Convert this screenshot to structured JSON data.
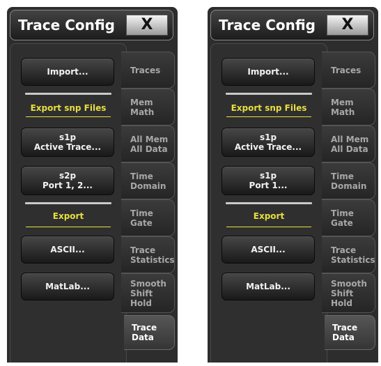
{
  "panels": [
    {
      "title": "Trace Config",
      "close_label": "X",
      "buttons": {
        "import": [
          "Import..."
        ],
        "s1p": [
          "s1p",
          "Active Trace..."
        ],
        "second": [
          "s2p",
          "Port 1, 2..."
        ],
        "ascii": [
          "ASCII..."
        ],
        "matlab": [
          "MatLab..."
        ]
      },
      "sections": {
        "export_snp": "Export snp Files",
        "export": "Export"
      },
      "tabs": [
        [
          "Traces"
        ],
        [
          "Mem",
          "Math"
        ],
        [
          "All Mem",
          "All Data"
        ],
        [
          "Time",
          "Domain"
        ],
        [
          "Time",
          "Gate"
        ],
        [
          "Trace",
          "Statistics"
        ],
        [
          "Smooth",
          "Shift",
          "Hold"
        ],
        [
          "Trace",
          "Data"
        ]
      ],
      "active_tab": 7
    },
    {
      "title": "Trace Config",
      "close_label": "X",
      "buttons": {
        "import": [
          "Import..."
        ],
        "s1p": [
          "s1p",
          "Active Trace..."
        ],
        "second": [
          "s1p",
          "Port 1..."
        ],
        "ascii": [
          "ASCII..."
        ],
        "matlab": [
          "MatLab..."
        ]
      },
      "sections": {
        "export_snp": "Export snp Files",
        "export": "Export"
      },
      "tabs": [
        [
          "Traces"
        ],
        [
          "Mem",
          "Math"
        ],
        [
          "All Mem",
          "All Data"
        ],
        [
          "Time",
          "Domain"
        ],
        [
          "Time",
          "Gate"
        ],
        [
          "Trace",
          "Statistics"
        ],
        [
          "Smooth",
          "Shift",
          "Hold"
        ],
        [
          "Trace",
          "Data"
        ]
      ],
      "active_tab": 7
    }
  ],
  "colors": {
    "panel_bg": "#2d2d2d",
    "accent_yellow": "#e8df3e",
    "tab_text": "#a8a8a8",
    "active_tab_text": "#ffffff"
  }
}
